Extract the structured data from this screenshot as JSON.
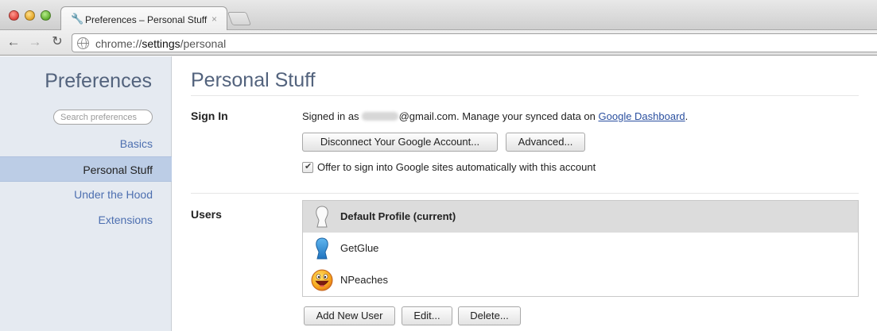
{
  "window": {
    "tab_title": "Preferences – Personal Stuff",
    "tab_close": "×",
    "url_scheme": "chrome://",
    "url_host": "settings",
    "url_path": "/personal"
  },
  "toolbar": {
    "back_glyph": "←",
    "forward_glyph": "→",
    "reload_glyph": "C"
  },
  "sidebar": {
    "title": "Preferences",
    "search_placeholder": "Search preferences",
    "items": [
      {
        "label": "Basics",
        "selected": false
      },
      {
        "label": "Personal Stuff",
        "selected": true
      },
      {
        "label": "Under the Hood",
        "selected": false
      },
      {
        "label": "Extensions",
        "selected": false
      }
    ]
  },
  "main": {
    "title": "Personal Stuff",
    "signin": {
      "label": "Sign In",
      "prefix": "Signed in as",
      "email_domain": "@gmail.com. Manage your synced data on",
      "dashboard_link": "Google Dashboard",
      "suffix": ".",
      "disconnect_button": "Disconnect Your Google Account...",
      "advanced_button": "Advanced...",
      "auto_signin_checked": true,
      "auto_signin_label": "Offer to sign into Google sites automatically with this account"
    },
    "users": {
      "label": "Users",
      "list": [
        {
          "name": "Default Profile (current)",
          "icon": "silhouette-white-icon",
          "selected": true
        },
        {
          "name": "GetGlue",
          "icon": "silhouette-blue-icon",
          "selected": false
        },
        {
          "name": "NPeaches",
          "icon": "smiley-face-icon",
          "selected": false
        }
      ],
      "add_button": "Add New User",
      "edit_button": "Edit...",
      "delete_button": "Delete..."
    }
  },
  "colors": {
    "heading": "#53637d",
    "link": "#4d6fb0",
    "sidebar_bg": "#e5eaf1",
    "sidebar_selected": "#bccde6",
    "row_selected": "#dcdcdc"
  }
}
